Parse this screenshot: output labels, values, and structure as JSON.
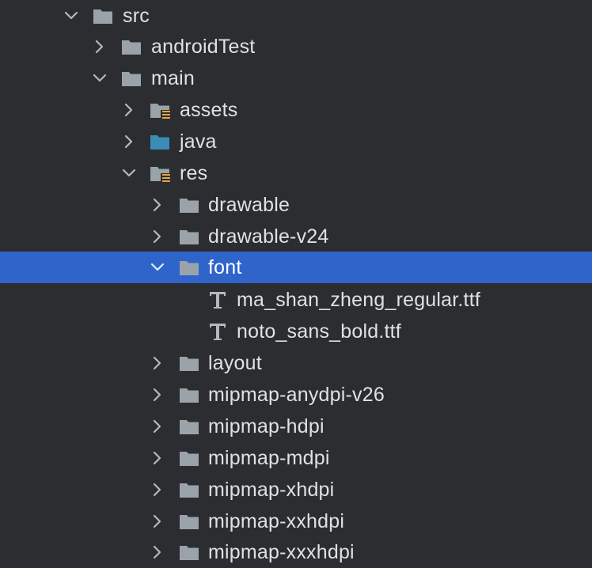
{
  "colors": {
    "background": "#2b2d30",
    "selection": "#2f65ca",
    "text": "#dfe1e5",
    "folder": "#9aa2aa",
    "source_folder": "#3d8cb8",
    "resource_marker": "#e8a33d"
  },
  "tree": {
    "nodes": [
      {
        "label": "src",
        "expanded": true,
        "icon": "folder-icon"
      },
      {
        "label": "androidTest",
        "expanded": false,
        "icon": "folder-icon"
      },
      {
        "label": "main",
        "expanded": true,
        "icon": "folder-icon"
      },
      {
        "label": "assets",
        "expanded": false,
        "icon": "resource-folder-icon"
      },
      {
        "label": "java",
        "expanded": false,
        "icon": "source-folder-icon"
      },
      {
        "label": "res",
        "expanded": true,
        "icon": "resource-folder-icon"
      },
      {
        "label": "drawable",
        "expanded": false,
        "icon": "folder-icon"
      },
      {
        "label": "drawable-v24",
        "expanded": false,
        "icon": "folder-icon"
      },
      {
        "label": "font",
        "expanded": true,
        "icon": "folder-icon",
        "selected": true
      },
      {
        "label": "ma_shan_zheng_regular.ttf",
        "icon": "font-file-icon"
      },
      {
        "label": "noto_sans_bold.ttf",
        "icon": "font-file-icon"
      },
      {
        "label": "layout",
        "expanded": false,
        "icon": "folder-icon"
      },
      {
        "label": "mipmap-anydpi-v26",
        "expanded": false,
        "icon": "folder-icon"
      },
      {
        "label": "mipmap-hdpi",
        "expanded": false,
        "icon": "folder-icon"
      },
      {
        "label": "mipmap-mdpi",
        "expanded": false,
        "icon": "folder-icon"
      },
      {
        "label": "mipmap-xhdpi",
        "expanded": false,
        "icon": "folder-icon"
      },
      {
        "label": "mipmap-xxhdpi",
        "expanded": false,
        "icon": "folder-icon"
      },
      {
        "label": "mipmap-xxxhdpi",
        "expanded": false,
        "icon": "folder-icon"
      }
    ]
  }
}
